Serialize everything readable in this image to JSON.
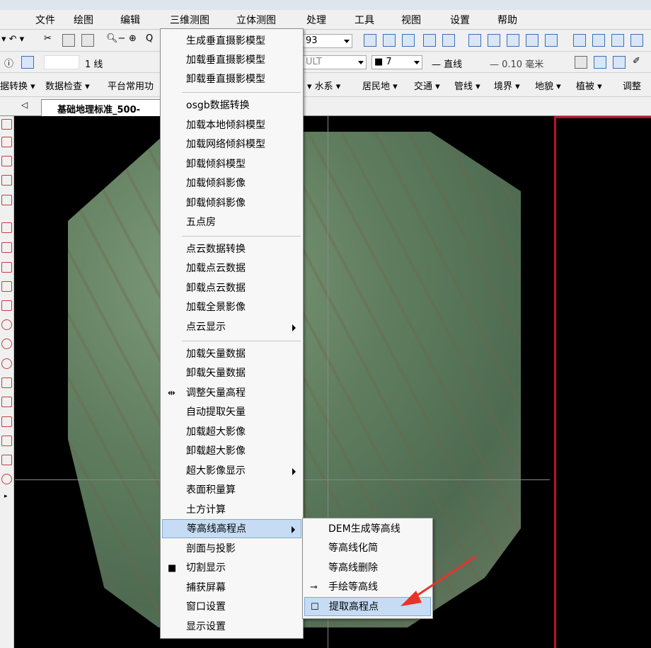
{
  "menubar": {
    "items": [
      "文件",
      "绘图",
      "编辑",
      "三维测图",
      "立体测图",
      "处理",
      "工具",
      "视图",
      "设置",
      "帮助"
    ]
  },
  "toolbar1": {
    "field_value": "93"
  },
  "toolbar2": {
    "line_label": "1 线",
    "layer_value": "ULT",
    "color_value": "■ 7",
    "linetype_label": "— 直线",
    "linewidth_label": "— 0.10 毫米"
  },
  "toolbar3": {
    "items": [
      "据转换 ▾",
      "数据检查 ▾",
      "平台常用功",
      "▾ 水系 ▾",
      "居民地 ▾",
      "交通 ▾",
      "管线 ▾",
      "境界 ▾",
      "地貌 ▾",
      "植被 ▾",
      "调整"
    ]
  },
  "tab": {
    "label": "基础地理标准_500-"
  },
  "menu": {
    "items": [
      "生成垂直摄影模型",
      "加载垂直摄影模型",
      "卸载垂直摄影模型",
      "osgb数据转换",
      "加载本地倾斜模型",
      "加载网络倾斜模型",
      "卸载倾斜模型",
      "加载倾斜影像",
      "卸载倾斜影像",
      "五点房",
      "点云数据转换",
      "加载点云数据",
      "卸载点云数据",
      "加载全景影像",
      "点云显示",
      "加载矢量数据",
      "卸载矢量数据",
      "调整矢量高程",
      "自动提取矢量",
      "加载超大影像",
      "卸载超大影像",
      "超大影像显示",
      "表面积量算",
      "土方计算",
      "等高线高程点",
      "剖面与投影",
      "切割显示",
      "捕获屏幕",
      "窗口设置",
      "显示设置"
    ],
    "highlighted": "等高线高程点"
  },
  "submenu": {
    "items": [
      "DEM生成等高线",
      "等高线化简",
      "等高线删除",
      "手绘等高线",
      "提取高程点"
    ],
    "highlighted": "提取高程点"
  },
  "colors": {
    "menu_highlight": "#c5dcf4",
    "highlight_border": "#7ea9dc",
    "annotation_arrow": "#e8322b",
    "pane_border": "#c0102a"
  }
}
